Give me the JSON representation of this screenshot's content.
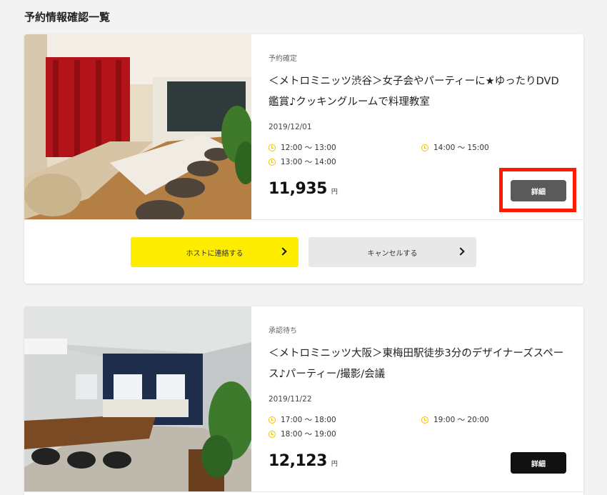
{
  "page": {
    "title": "予約情報確認一覧"
  },
  "reservations": [
    {
      "status": "予約確定",
      "title": "＜メトロミニッツ渋谷＞女子会やパーティーに★ゆったりDVD鑑賞♪クッキングルームで料理教室",
      "date": "2019/12/01",
      "slots": [
        "12:00 〜 13:00",
        "14:00 〜 15:00",
        "13:00 〜 14:00"
      ],
      "price": "11,935",
      "unit": "円",
      "detail_label": "詳細",
      "contact_label": "ホストに連絡する",
      "cancel_label": "キャンセルする"
    },
    {
      "status": "承認待ち",
      "title": "＜メトロミニッツ大阪＞東梅田駅徒歩3分のデザイナーズスペース♪パーティー/撮影/会議",
      "date": "2019/11/22",
      "slots": [
        "17:00 〜 18:00",
        "19:00 〜 20:00",
        "18:00 〜 19:00"
      ],
      "price": "12,123",
      "unit": "円",
      "detail_label": "詳細"
    }
  ],
  "colors": {
    "accent_yellow": "#ffed00",
    "clock_yellow": "#f2c200",
    "highlight_red": "#ff1a00",
    "detail_gray": "#5a5a5a",
    "detail_black": "#111111"
  }
}
